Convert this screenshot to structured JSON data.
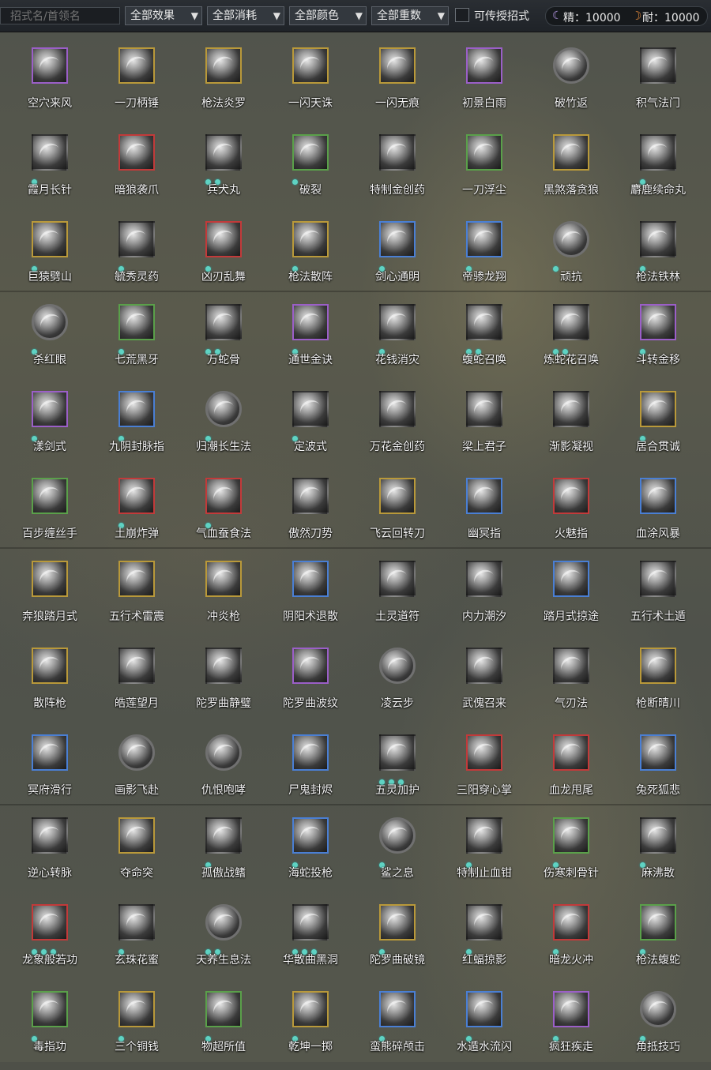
{
  "search": {
    "placeholder": "招式名/首领名"
  },
  "filters": [
    {
      "label": "全部效果",
      "left": 0
    },
    {
      "label": "全部消耗"
    },
    {
      "label": "全部颜色"
    },
    {
      "label": "全部重数"
    }
  ],
  "transferable_label": "可传授招式",
  "resources": {
    "jing": "精：10000",
    "nai": "耐：10000"
  },
  "skills": [
    {
      "name": "空穴来风",
      "color": "purple",
      "shape": "square",
      "dots": 0
    },
    {
      "name": "一刀柄锤",
      "color": "gold",
      "shape": "square",
      "dots": 0
    },
    {
      "name": "枪法炎罗",
      "color": "gold",
      "shape": "square",
      "dots": 0
    },
    {
      "name": "一闪天诛",
      "color": "gold",
      "shape": "square",
      "dots": 0
    },
    {
      "name": "一闪无痕",
      "color": "gold",
      "shape": "square",
      "dots": 0
    },
    {
      "name": "初景白雨",
      "color": "purple",
      "shape": "square",
      "dots": 0
    },
    {
      "name": "破竹返",
      "color": "grey",
      "shape": "round",
      "dots": 0
    },
    {
      "name": "积气法门",
      "color": "none",
      "shape": "square",
      "dots": 0
    },
    {
      "name": "霞月长针",
      "color": "none",
      "shape": "square",
      "dots": 1
    },
    {
      "name": "暗狼袭爪",
      "color": "red",
      "shape": "square",
      "dots": 0
    },
    {
      "name": "兵犬丸",
      "color": "none",
      "shape": "square",
      "dots": 2
    },
    {
      "name": "破裂",
      "color": "green",
      "shape": "square",
      "dots": 1
    },
    {
      "name": "特制金创药",
      "color": "none",
      "shape": "square",
      "dots": 0
    },
    {
      "name": "一刀浮尘",
      "color": "green",
      "shape": "square",
      "dots": 0
    },
    {
      "name": "黑煞落贪狼",
      "color": "gold",
      "shape": "square",
      "dots": 0
    },
    {
      "name": "麝鹿续命丸",
      "color": "none",
      "shape": "square",
      "dots": 1
    },
    {
      "name": "巨猿劈山",
      "color": "gold",
      "shape": "square",
      "dots": 1
    },
    {
      "name": "毓秀灵药",
      "color": "none",
      "shape": "square",
      "dots": 1
    },
    {
      "name": "凶刃乱舞",
      "color": "red",
      "shape": "square",
      "dots": 1
    },
    {
      "name": "枪法散阵",
      "color": "gold",
      "shape": "square",
      "dots": 1
    },
    {
      "name": "剑心通明",
      "color": "blue",
      "shape": "square",
      "dots": 1
    },
    {
      "name": "帝骖龙翔",
      "color": "blue",
      "shape": "square",
      "dots": 1
    },
    {
      "name": "顽抗",
      "color": "grey",
      "shape": "round",
      "dots": 1
    },
    {
      "name": "枪法铁林",
      "color": "none",
      "shape": "square",
      "dots": 1
    },
    {
      "name": "杀红眼",
      "color": "grey",
      "shape": "round",
      "dots": 1
    },
    {
      "name": "七荒黑牙",
      "color": "green",
      "shape": "square",
      "dots": 1
    },
    {
      "name": "万蛇骨",
      "color": "none",
      "shape": "square",
      "dots": 2
    },
    {
      "name": "通世金诀",
      "color": "purple",
      "shape": "square",
      "dots": 1
    },
    {
      "name": "花钱消灾",
      "color": "none",
      "shape": "square",
      "dots": 1
    },
    {
      "name": "蝮蛇召唤",
      "color": "none",
      "shape": "square",
      "dots": 2
    },
    {
      "name": "炼蛇花召唤",
      "color": "none",
      "shape": "square",
      "dots": 2
    },
    {
      "name": "斗转金移",
      "color": "purple",
      "shape": "square",
      "dots": 1
    },
    {
      "name": "漾剑式",
      "color": "purple",
      "shape": "square",
      "dots": 1
    },
    {
      "name": "九阴封脉指",
      "color": "blue",
      "shape": "square",
      "dots": 1
    },
    {
      "name": "归潮长生法",
      "color": "grey",
      "shape": "round",
      "dots": 1
    },
    {
      "name": "定波式",
      "color": "none",
      "shape": "square",
      "dots": 1
    },
    {
      "name": "万花金创药",
      "color": "none",
      "shape": "square",
      "dots": 0
    },
    {
      "name": "梁上君子",
      "color": "none",
      "shape": "square",
      "dots": 0
    },
    {
      "name": "渐影凝视",
      "color": "none",
      "shape": "square",
      "dots": 0
    },
    {
      "name": "居合贯诚",
      "color": "gold",
      "shape": "square",
      "dots": 1
    },
    {
      "name": "百步缠丝手",
      "color": "green",
      "shape": "square",
      "dots": 0
    },
    {
      "name": "土崩炸弹",
      "color": "red",
      "shape": "square",
      "dots": 1
    },
    {
      "name": "气血蚕食法",
      "color": "red",
      "shape": "square",
      "dots": 1
    },
    {
      "name": "傲然刀势",
      "color": "none",
      "shape": "square",
      "dots": 0
    },
    {
      "name": "飞云回转刀",
      "color": "gold",
      "shape": "square",
      "dots": 0
    },
    {
      "name": "幽冥指",
      "color": "blue",
      "shape": "square",
      "dots": 0
    },
    {
      "name": "火魅指",
      "color": "red",
      "shape": "square",
      "dots": 0
    },
    {
      "name": "血涂风暴",
      "color": "blue",
      "shape": "square",
      "dots": 0
    },
    {
      "name": "奔狼踏月式",
      "color": "gold",
      "shape": "square",
      "dots": 0
    },
    {
      "name": "五行术雷震",
      "color": "gold",
      "shape": "square",
      "dots": 0
    },
    {
      "name": "冲炎枪",
      "color": "gold",
      "shape": "square",
      "dots": 0
    },
    {
      "name": "阴阳术退散",
      "color": "blue",
      "shape": "square",
      "dots": 0
    },
    {
      "name": "土灵道符",
      "color": "none",
      "shape": "square",
      "dots": 0
    },
    {
      "name": "内力潮汐",
      "color": "none",
      "shape": "square",
      "dots": 0
    },
    {
      "name": "踏月式掠途",
      "color": "blue",
      "shape": "square",
      "dots": 0
    },
    {
      "name": "五行术土遁",
      "color": "none",
      "shape": "square",
      "dots": 0
    },
    {
      "name": "散阵枪",
      "color": "gold",
      "shape": "square",
      "dots": 0
    },
    {
      "name": "皓莲望月",
      "color": "none",
      "shape": "square",
      "dots": 0
    },
    {
      "name": "陀罗曲静璧",
      "color": "none",
      "shape": "square",
      "dots": 0
    },
    {
      "name": "陀罗曲波纹",
      "color": "purple",
      "shape": "square",
      "dots": 0
    },
    {
      "name": "凌云步",
      "color": "grey",
      "shape": "round",
      "dots": 0
    },
    {
      "name": "武傀召来",
      "color": "none",
      "shape": "square",
      "dots": 0
    },
    {
      "name": "气刃法",
      "color": "none",
      "shape": "square",
      "dots": 0
    },
    {
      "name": "枪断晴川",
      "color": "gold",
      "shape": "square",
      "dots": 0
    },
    {
      "name": "冥府滑行",
      "color": "blue",
      "shape": "square",
      "dots": 0
    },
    {
      "name": "画影飞赴",
      "color": "grey",
      "shape": "round",
      "dots": 0
    },
    {
      "name": "仇恨咆哮",
      "color": "grey",
      "shape": "round",
      "dots": 0
    },
    {
      "name": "尸鬼封烬",
      "color": "blue",
      "shape": "square",
      "dots": 0
    },
    {
      "name": "五灵加护",
      "color": "none",
      "shape": "square",
      "dots": 3
    },
    {
      "name": "三阳穿心掌",
      "color": "red",
      "shape": "square",
      "dots": 0
    },
    {
      "name": "血龙甩尾",
      "color": "red",
      "shape": "square",
      "dots": 0
    },
    {
      "name": "兔死狐悲",
      "color": "blue",
      "shape": "square",
      "dots": 0
    },
    {
      "name": "逆心转脉",
      "color": "none",
      "shape": "square",
      "dots": 0
    },
    {
      "name": "夺命突",
      "color": "gold",
      "shape": "square",
      "dots": 0
    },
    {
      "name": "孤傲战鳍",
      "color": "none",
      "shape": "square",
      "dots": 1
    },
    {
      "name": "海蛇投枪",
      "color": "blue",
      "shape": "square",
      "dots": 1
    },
    {
      "name": "鲨之息",
      "color": "grey",
      "shape": "round",
      "dots": 1
    },
    {
      "name": "特制止血钳",
      "color": "none",
      "shape": "square",
      "dots": 1
    },
    {
      "name": "伤寒刺骨针",
      "color": "green",
      "shape": "square",
      "dots": 1
    },
    {
      "name": "麻沸散",
      "color": "none",
      "shape": "square",
      "dots": 1
    },
    {
      "name": "龙象般若功",
      "color": "red",
      "shape": "square",
      "dots": 3
    },
    {
      "name": "玄珠花蜜",
      "color": "none",
      "shape": "square",
      "dots": 1
    },
    {
      "name": "天养生息法",
      "color": "grey",
      "shape": "round",
      "dots": 2
    },
    {
      "name": "华散曲黑洞",
      "color": "none",
      "shape": "square",
      "dots": 3
    },
    {
      "name": "陀罗曲破镜",
      "color": "gold",
      "shape": "square",
      "dots": 1
    },
    {
      "name": "红蝠掠影",
      "color": "none",
      "shape": "square",
      "dots": 1
    },
    {
      "name": "暗龙火冲",
      "color": "red",
      "shape": "square",
      "dots": 1
    },
    {
      "name": "枪法蝮蛇",
      "color": "green",
      "shape": "square",
      "dots": 1
    },
    {
      "name": "毒指功",
      "color": "green",
      "shape": "square",
      "dots": 1
    },
    {
      "name": "三个铜钱",
      "color": "gold",
      "shape": "square",
      "dots": 1
    },
    {
      "name": "物超所值",
      "color": "green",
      "shape": "square",
      "dots": 1
    },
    {
      "name": "乾坤一掷",
      "color": "gold",
      "shape": "square",
      "dots": 1
    },
    {
      "name": "蛮熊碎颅击",
      "color": "blue",
      "shape": "square",
      "dots": 1
    },
    {
      "name": "水遁水流闪",
      "color": "blue",
      "shape": "square",
      "dots": 1
    },
    {
      "name": "疯狂疾走",
      "color": "purple",
      "shape": "square",
      "dots": 1
    },
    {
      "name": "角抵技巧",
      "color": "grey",
      "shape": "round",
      "dots": 1
    }
  ]
}
